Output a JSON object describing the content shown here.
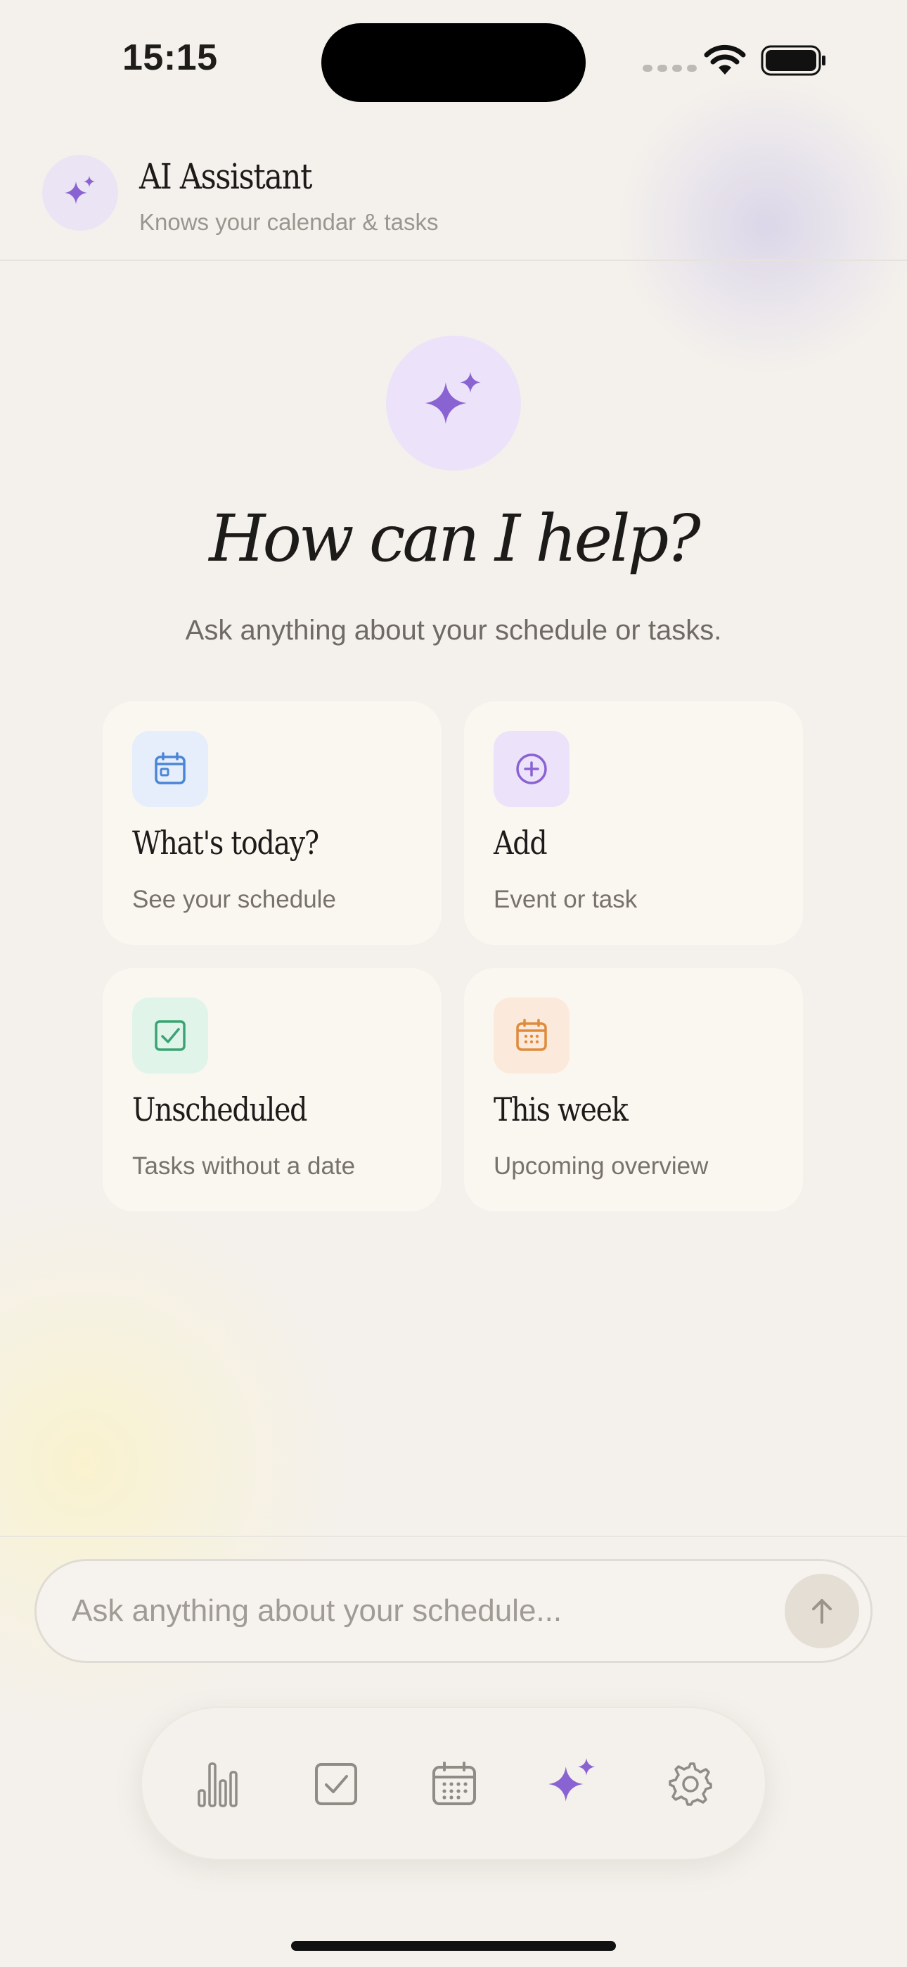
{
  "status_bar": {
    "time": "15:15"
  },
  "header": {
    "title": "AI Assistant",
    "subtitle": "Knows your calendar & tasks",
    "avatar_icon": "sparkles-icon"
  },
  "hero": {
    "icon": "sparkles-icon",
    "title": "How can I help?",
    "subtitle": "Ask anything about your schedule or tasks."
  },
  "suggestions": [
    {
      "title": "What's today?",
      "subtitle": "See your schedule",
      "icon": "calendar-today-icon",
      "accent": "#4a86d6",
      "background": "#e6eefb"
    },
    {
      "title": "Add",
      "subtitle": "Event or task",
      "icon": "plus-circle-icon",
      "accent": "#8a63d2",
      "background": "#ece3fa"
    },
    {
      "title": "Unscheduled",
      "subtitle": "Tasks without a date",
      "icon": "checkbox-icon",
      "accent": "#3aa373",
      "background": "#e1f4ea"
    },
    {
      "title": "This week",
      "subtitle": "Upcoming overview",
      "icon": "calendar-grid-icon",
      "accent": "#e08a3c",
      "background": "#fbeadb"
    }
  ],
  "chat_input": {
    "placeholder": "Ask anything about your schedule..."
  },
  "tab_bar": {
    "items": [
      {
        "name": "stats",
        "icon": "bar-chart-icon",
        "active": false
      },
      {
        "name": "tasks",
        "icon": "checkbox-icon",
        "active": false
      },
      {
        "name": "calendar",
        "icon": "calendar-grid-icon",
        "active": false
      },
      {
        "name": "assistant",
        "icon": "sparkles-icon",
        "active": true
      },
      {
        "name": "settings",
        "icon": "gear-icon",
        "active": false
      }
    ]
  },
  "colors": {
    "accent": "#8a63d2",
    "background": "#f4f1ec",
    "card": "#faf7f1",
    "muted_icon": "#8f8b85"
  }
}
